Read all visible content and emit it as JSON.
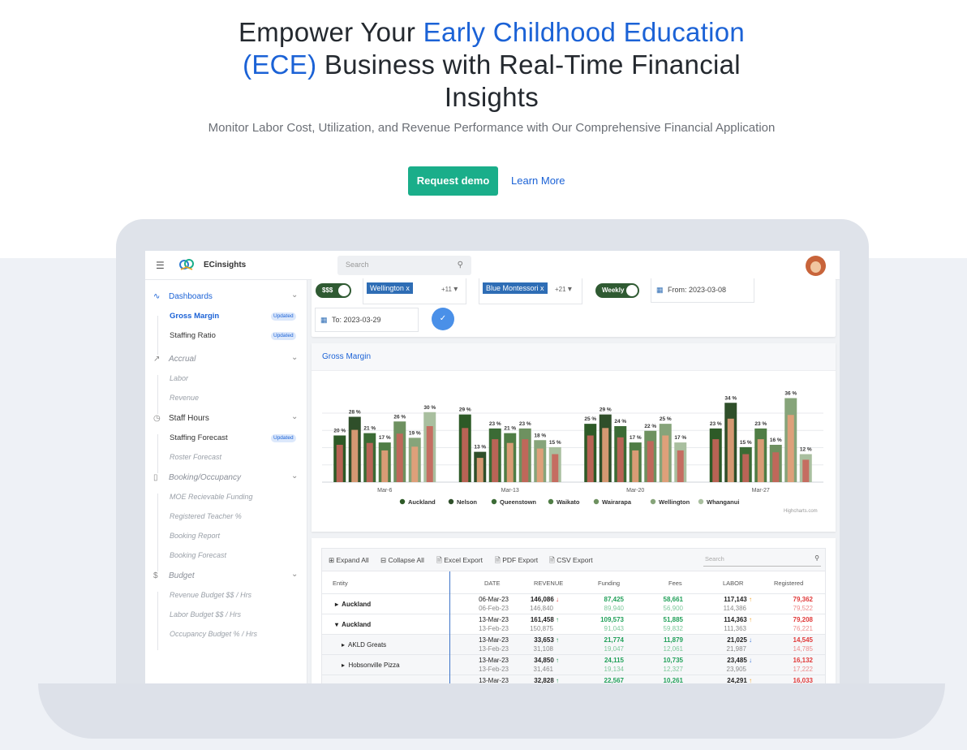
{
  "hero": {
    "title_part1": "Empower Your ",
    "title_accent": "Early Childhood Education (ECE)",
    "title_part2": " Business with Real-Time Financial Insights",
    "subtitle": "Monitor Labor Cost, Utilization, and Revenue Performance with Our Comprehensive Financial Application",
    "demo_button": "Request demo",
    "learn_button": "Learn More"
  },
  "app": {
    "brand": "ECinsights",
    "search_placeholder": "Search"
  },
  "sidebar": {
    "groups": [
      {
        "label": "Dashboards",
        "items": [
          {
            "label": "Gross Margin",
            "badge": "Updated"
          },
          {
            "label": "Staffing Ratio",
            "badge": "Updated"
          }
        ]
      },
      {
        "label": "Accrual",
        "items": [
          {
            "label": "Labor"
          },
          {
            "label": "Revenue"
          }
        ]
      },
      {
        "label": "Staff Hours",
        "items": [
          {
            "label": "Staffing Forecast",
            "badge": "Updated"
          },
          {
            "label": "Roster Forecast"
          }
        ]
      },
      {
        "label": "Booking/Occupancy",
        "items": [
          {
            "label": "MOE Recievable Funding"
          },
          {
            "label": "Registered Teacher %"
          },
          {
            "label": "Booking Report"
          },
          {
            "label": "Booking Forecast"
          }
        ]
      },
      {
        "label": "Budget",
        "items": [
          {
            "label": "Revenue Budget $$ / Hrs"
          },
          {
            "label": "Labor Budget $$ / Hrs"
          },
          {
            "label": "Occupancy Budget % / Hrs"
          }
        ]
      }
    ]
  },
  "filters": {
    "currency_toggle": "$$$",
    "region_chip": "Wellington",
    "region_more": "+11",
    "center_chip": "Blue Montessori",
    "center_more": "+21",
    "period_toggle": "Weekly",
    "from_date": "From: 2023-03-08",
    "to_date": "To: 2023-03-29"
  },
  "chart_card": {
    "title": "Gross Margin",
    "credit": "Highcharts.com"
  },
  "chart_data": {
    "type": "bar",
    "title": "Gross Margin",
    "categories": [
      "Mar-6",
      "Mar-13",
      "Mar-20",
      "Mar-27"
    ],
    "series": [
      {
        "name": "Auckland",
        "color": "#2d5a27",
        "values": [
          20,
          29,
          25,
          23
        ]
      },
      {
        "name": "Nelson",
        "color": "#2f4f2a",
        "values": [
          28,
          13,
          29,
          34
        ]
      },
      {
        "name": "Queenstown",
        "color": "#3b6b35",
        "values": [
          21,
          23,
          24,
          15
        ]
      },
      {
        "name": "Waikato",
        "color": "#4f7d45",
        "values": [
          17,
          21,
          17,
          23
        ]
      },
      {
        "name": "Wairarapa",
        "color": "#6e9160",
        "values": [
          26,
          23,
          22,
          16
        ]
      },
      {
        "name": "Wellington",
        "color": "#86a47a",
        "values": [
          19,
          18,
          25,
          36
        ]
      },
      {
        "name": "Whanganui",
        "color": "#a9bf9f",
        "values": [
          30,
          15,
          17,
          12
        ]
      }
    ],
    "ylim": [
      0,
      40
    ],
    "grid": true,
    "legend": "bottom"
  },
  "table": {
    "tools": [
      "Expand All",
      "Collapse All",
      "Excel Export",
      "PDF Export",
      "CSV Export"
    ],
    "search_placeholder": "Search",
    "headers": [
      "Entity",
      "DATE",
      "REVENUE",
      "Funding",
      "Fees",
      "LABOR",
      "Registered"
    ],
    "rows": [
      {
        "entity": "Auckland",
        "caret": "▸",
        "d1": "06-Mar-23",
        "d2": "06-Feb-23",
        "rev1": "146,086",
        "rev_arrow": "↓",
        "rev2": "146,840",
        "fund1": "87,425",
        "fund2": "89,940",
        "fee1": "58,661",
        "fee2": "56,900",
        "lab1": "117,143",
        "lab_arrow": "↑",
        "lab2": "114,386",
        "reg1": "79,362",
        "reg2": "79,522"
      },
      {
        "entity": "Auckland",
        "caret": "▾",
        "d1": "13-Mar-23",
        "d2": "13-Feb-23",
        "rev1": "161,458",
        "rev_arrow": "↑",
        "rev2": "150,875",
        "fund1": "109,573",
        "fund2": "91,043",
        "fee1": "51,885",
        "fee2": "59,832",
        "lab1": "114,363",
        "lab_arrow": "↑",
        "lab2": "111,363",
        "reg1": "79,208",
        "reg2": "76,221"
      },
      {
        "entity": "AKLD Greats",
        "caret": "▸",
        "d1": "13-Mar-23",
        "d2": "13-Feb-23",
        "rev1": "33,653",
        "rev_arrow": "↑",
        "rev2": "31,108",
        "fund1": "21,774",
        "fund2": "19,047",
        "fee1": "11,879",
        "fee2": "12,061",
        "lab1": "21,025",
        "lab_arrow": "↓",
        "lab2": "21,987",
        "reg1": "14,545",
        "reg2": "14,785"
      },
      {
        "entity": "Hobsonville Pizza",
        "caret": "▸",
        "d1": "13-Mar-23",
        "d2": "13-Feb-23",
        "rev1": "34,850",
        "rev_arrow": "↑",
        "rev2": "31,461",
        "fund1": "24,115",
        "fund2": "19,134",
        "fee1": "10,735",
        "fee2": "12,327",
        "lab1": "23,485",
        "lab_arrow": "↓",
        "lab2": "23,905",
        "reg1": "16,132",
        "reg2": "17,222"
      },
      {
        "entity": "",
        "caret": "",
        "d1": "13-Mar-23",
        "d2": "",
        "rev1": "32,828",
        "rev_arrow": "↑",
        "rev2": "",
        "fund1": "22,567",
        "fund2": "",
        "fee1": "10,261",
        "fee2": "",
        "lab1": "24,291",
        "lab_arrow": "↑",
        "lab2": "",
        "reg1": "16,033",
        "reg2": ""
      }
    ]
  }
}
